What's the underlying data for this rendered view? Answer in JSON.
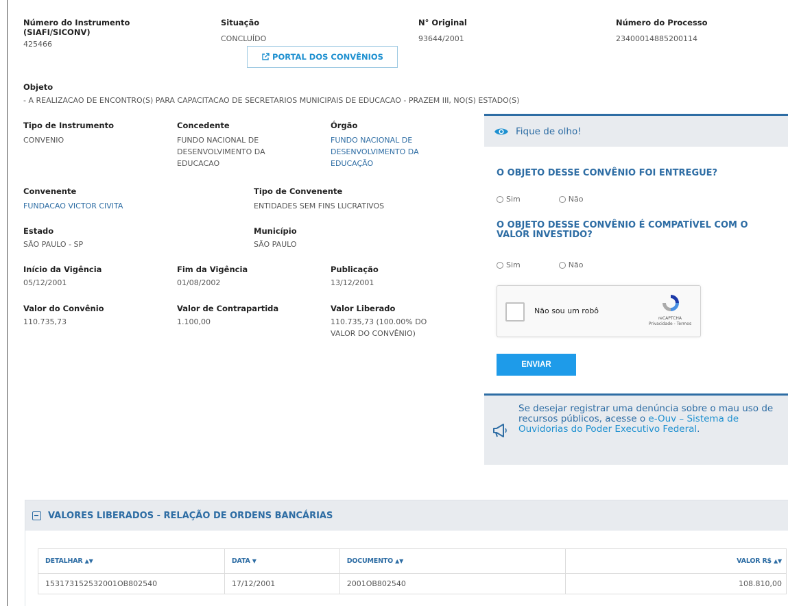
{
  "header": {
    "numero_instrumento_label": "Número do Instrumento (SIAFI/SICONV)",
    "numero_instrumento_value": "425466",
    "situacao_label": "Situação",
    "situacao_value": "CONCLUÍDO",
    "original_label": "N° Original",
    "original_value": "93644/2001",
    "processo_label": "Número do Processo",
    "processo_value": "23400014885200114",
    "portal_button": "PORTAL DOS CONVÊNIOS"
  },
  "objeto": {
    "label": "Objeto",
    "value": "- A REALIZACAO DE ENCONTRO(S) PARA CAPACITACAO DE SECRETARIOS MUNICIPAIS DE EDUCACAO - PRAZEM III, NO(S) ESTADO(S)"
  },
  "details": {
    "tipo_instrumento_label": "Tipo de Instrumento",
    "tipo_instrumento_value": "CONVENIO",
    "concedente_label": "Concedente",
    "concedente_lines": [
      "FUNDO NACIONAL DE",
      "DESENVOLVIMENTO DA",
      "EDUCACAO"
    ],
    "orgao_label": "Órgão",
    "orgao_lines": [
      "FUNDO NACIONAL DE",
      "DESENVOLVIMENTO DA",
      "EDUCAÇÃO"
    ],
    "convenente_label": "Convenente",
    "convenente_value": "FUNDACAO VICTOR CIVITA",
    "tipo_convenente_label": "Tipo de Convenente",
    "tipo_convenente_value": "ENTIDADES SEM FINS LUCRATIVOS",
    "estado_label": "Estado",
    "estado_value": "SÃO PAULO - SP",
    "municipio_label": "Município",
    "municipio_value": "SÃO PAULO",
    "inicio_label": "Início da Vigência",
    "inicio_value": "05/12/2001",
    "fim_label": "Fim da Vigência",
    "fim_value": "01/08/2002",
    "publicacao_label": "Publicação",
    "publicacao_value": "13/12/2001",
    "valor_convenio_label": "Valor do Convênio",
    "valor_convenio_value": "110.735,73",
    "contrapartida_label": "Valor de Contrapartida",
    "contrapartida_value": "1.100,00",
    "liberado_label": "Valor Liberado",
    "liberado_lines": [
      "110.735,73 (100.00% DO",
      "VALOR DO CONVÊNIO)"
    ]
  },
  "panel": {
    "title": "Fique de olho!",
    "q1": "O OBJETO DESSE CONVÊNIO FOI ENTREGUE?",
    "q2": "O OBJETO DESSE CONVÊNIO É COMPATÍVEL COM O VALOR INVESTIDO?",
    "yes": "Sim",
    "no": "Não",
    "recaptcha_text": "Não sou um robô",
    "recaptcha_brand": "reCAPTCHA",
    "recaptcha_links": "Privacidade - Termos",
    "send": "ENVIAR",
    "footer_text": "Se desejar registrar uma denúncia sobre o mau uso de recursos públicos, acesse o ",
    "footer_link": "e-Ouv – Sistema de Ouvidorias do Poder Executivo Federal",
    "footer_end": "."
  },
  "section": {
    "title": "VALORES LIBERADOS - RELAÇÃO DE ORDENS BANCÁRIAS",
    "columns": [
      "DETALHAR",
      "DATA",
      "DOCUMENTO",
      "VALOR R$"
    ],
    "rows": [
      [
        "153173152532001OB802540",
        "17/12/2001",
        "2001OB802540",
        "108.810,00"
      ]
    ]
  },
  "colors": {
    "accent": "#2e6da4",
    "button": "#1e9be9",
    "panel_bg": "#e8ebef"
  }
}
